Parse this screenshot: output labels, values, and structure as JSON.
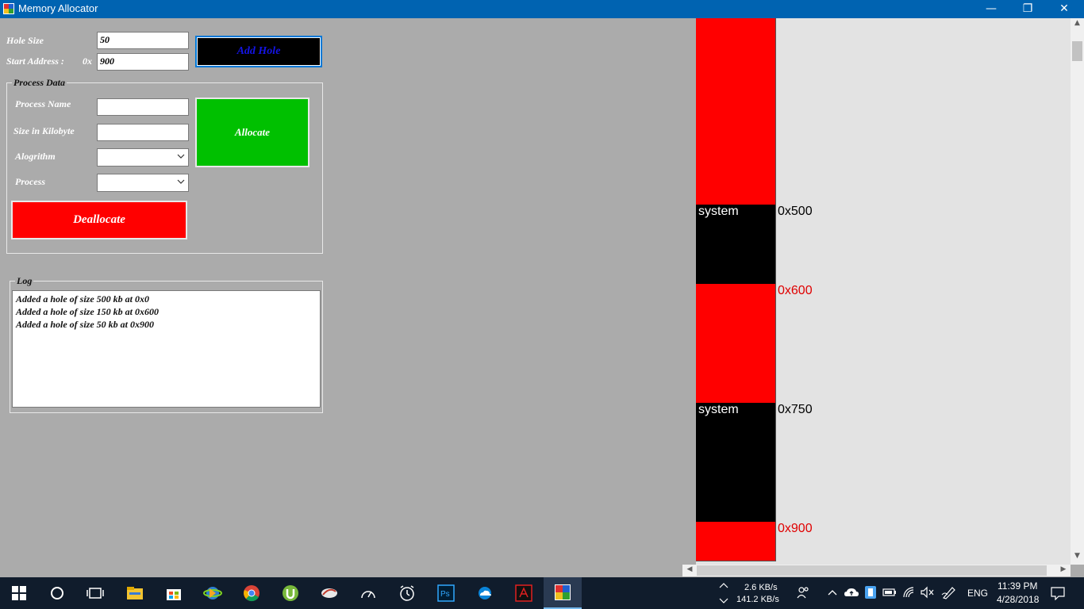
{
  "window": {
    "title": "Memory Allocator",
    "minimize_glyph": "—",
    "restore_glyph": "❐",
    "close_glyph": "✕"
  },
  "hole_form": {
    "hole_size_label": "Hole Size",
    "hole_size_value": "50",
    "start_address_label": "Start Address :",
    "address_prefix": "0x",
    "start_address_value": "900",
    "add_hole_label": "Add Hole"
  },
  "process_data": {
    "group_title": "Process Data",
    "process_name_label": "Process Name",
    "process_name_value": "",
    "size_label": "Size in Kilobyte",
    "size_value": "",
    "algorithm_label": "Alogrithm",
    "algorithm_value": "",
    "process_label": "Process",
    "process_value": "",
    "allocate_label": "Allocate",
    "deallocate_label": "Deallocate"
  },
  "log": {
    "group_title": "Log",
    "lines": [
      "Added a hole of size 500 kb at 0x0",
      "Added a hole of size 150 kb at 0x600",
      "Added a hole of size 50 kb at 0x900"
    ]
  },
  "memory": {
    "blocks": [
      {
        "label": "",
        "kind": "free",
        "color": "#ff0000"
      },
      {
        "label": "system",
        "kind": "system",
        "color": "#000000",
        "address": "0x500",
        "address_color": "#000000"
      },
      {
        "label": "",
        "kind": "free",
        "color": "#ff0000",
        "address": "0x600",
        "address_color": "#e00000"
      },
      {
        "label": "system",
        "kind": "system",
        "color": "#000000",
        "address": "0x750",
        "address_color": "#000000"
      },
      {
        "label": "",
        "kind": "free",
        "color": "#ff0000",
        "address": "0x900",
        "address_color": "#e00000"
      }
    ]
  },
  "taskbar": {
    "apps": [
      "start-icon",
      "cortana-icon",
      "task-view-icon",
      "file-explorer-icon",
      "store-icon",
      "idm-icon",
      "chrome-icon",
      "utorrent-icon",
      "app-icon",
      "speed-icon",
      "alarm-icon",
      "photoshop-icon",
      "onedrive-icon",
      "acrobat-icon",
      "memory-allocator-icon"
    ],
    "net_up": "2.6 KB/s",
    "net_down": "141.2 KB/s",
    "language": "ENG",
    "time": "11:39 PM",
    "date": "4/28/2018"
  },
  "colors": {
    "titlebar": "#0063b1",
    "free_block": "#ff0000",
    "system_block": "#000000",
    "allocate_button": "#00c000",
    "deallocate_button": "#ff0000"
  }
}
